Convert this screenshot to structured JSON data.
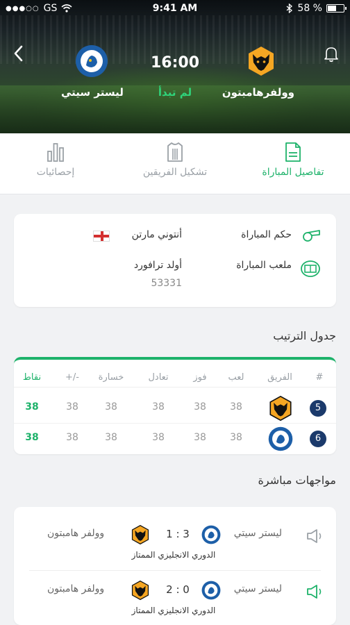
{
  "status_bar": {
    "carrier": "GS",
    "time": "9:41 AM",
    "battery": "58 %"
  },
  "match": {
    "home_team": "وولفرهامبتون",
    "away_team": "ليستر سيتي",
    "kickoff_time": "16:00",
    "status": "لم تبدأ"
  },
  "tabs": [
    {
      "label": "تفاصيل المباراة",
      "icon": "document-icon",
      "active": true
    },
    {
      "label": "تشكيل الفريقين",
      "icon": "jersey-icon",
      "active": false
    },
    {
      "label": "إحصائيات",
      "icon": "bar-chart-icon",
      "active": false
    }
  ],
  "info": {
    "referee_label": "حكم المباراة",
    "referee_name": "أنتوني مارتن",
    "stadium_label": "ملعب المباراة",
    "stadium_name": "أولد ترافورد",
    "capacity": "53331"
  },
  "standings": {
    "title": "جدول الترتيب",
    "headers": [
      "#",
      "الفريق",
      "لعب",
      "فوز",
      "تعادل",
      "خسارة",
      "-/+",
      "نقاط"
    ],
    "rows": [
      {
        "rank": "5",
        "team": "wolves",
        "p": "38",
        "w": "38",
        "d": "38",
        "l": "38",
        "diff": "38",
        "pts": "38"
      },
      {
        "rank": "6",
        "team": "leicester",
        "p": "38",
        "w": "38",
        "d": "38",
        "l": "38",
        "diff": "38",
        "pts": "38"
      }
    ]
  },
  "h2h": {
    "title": "مواجهات مباشرة",
    "matches": [
      {
        "home": "ليستر سيتي",
        "away": "وولفر هامبتون",
        "score": "1 : 3",
        "competition": "الدوري الانجليزي الممتاز"
      },
      {
        "home": "ليستر سيتي",
        "away": "وولفر هامبتون",
        "score": "2 : 0",
        "competition": "الدوري الانجليزي الممتاز"
      }
    ]
  },
  "colors": {
    "accent": "#1db26a",
    "rank_badge": "#1b3a6b",
    "wolves_gold": "#f5a623",
    "leicester_blue": "#1d5fa8"
  }
}
